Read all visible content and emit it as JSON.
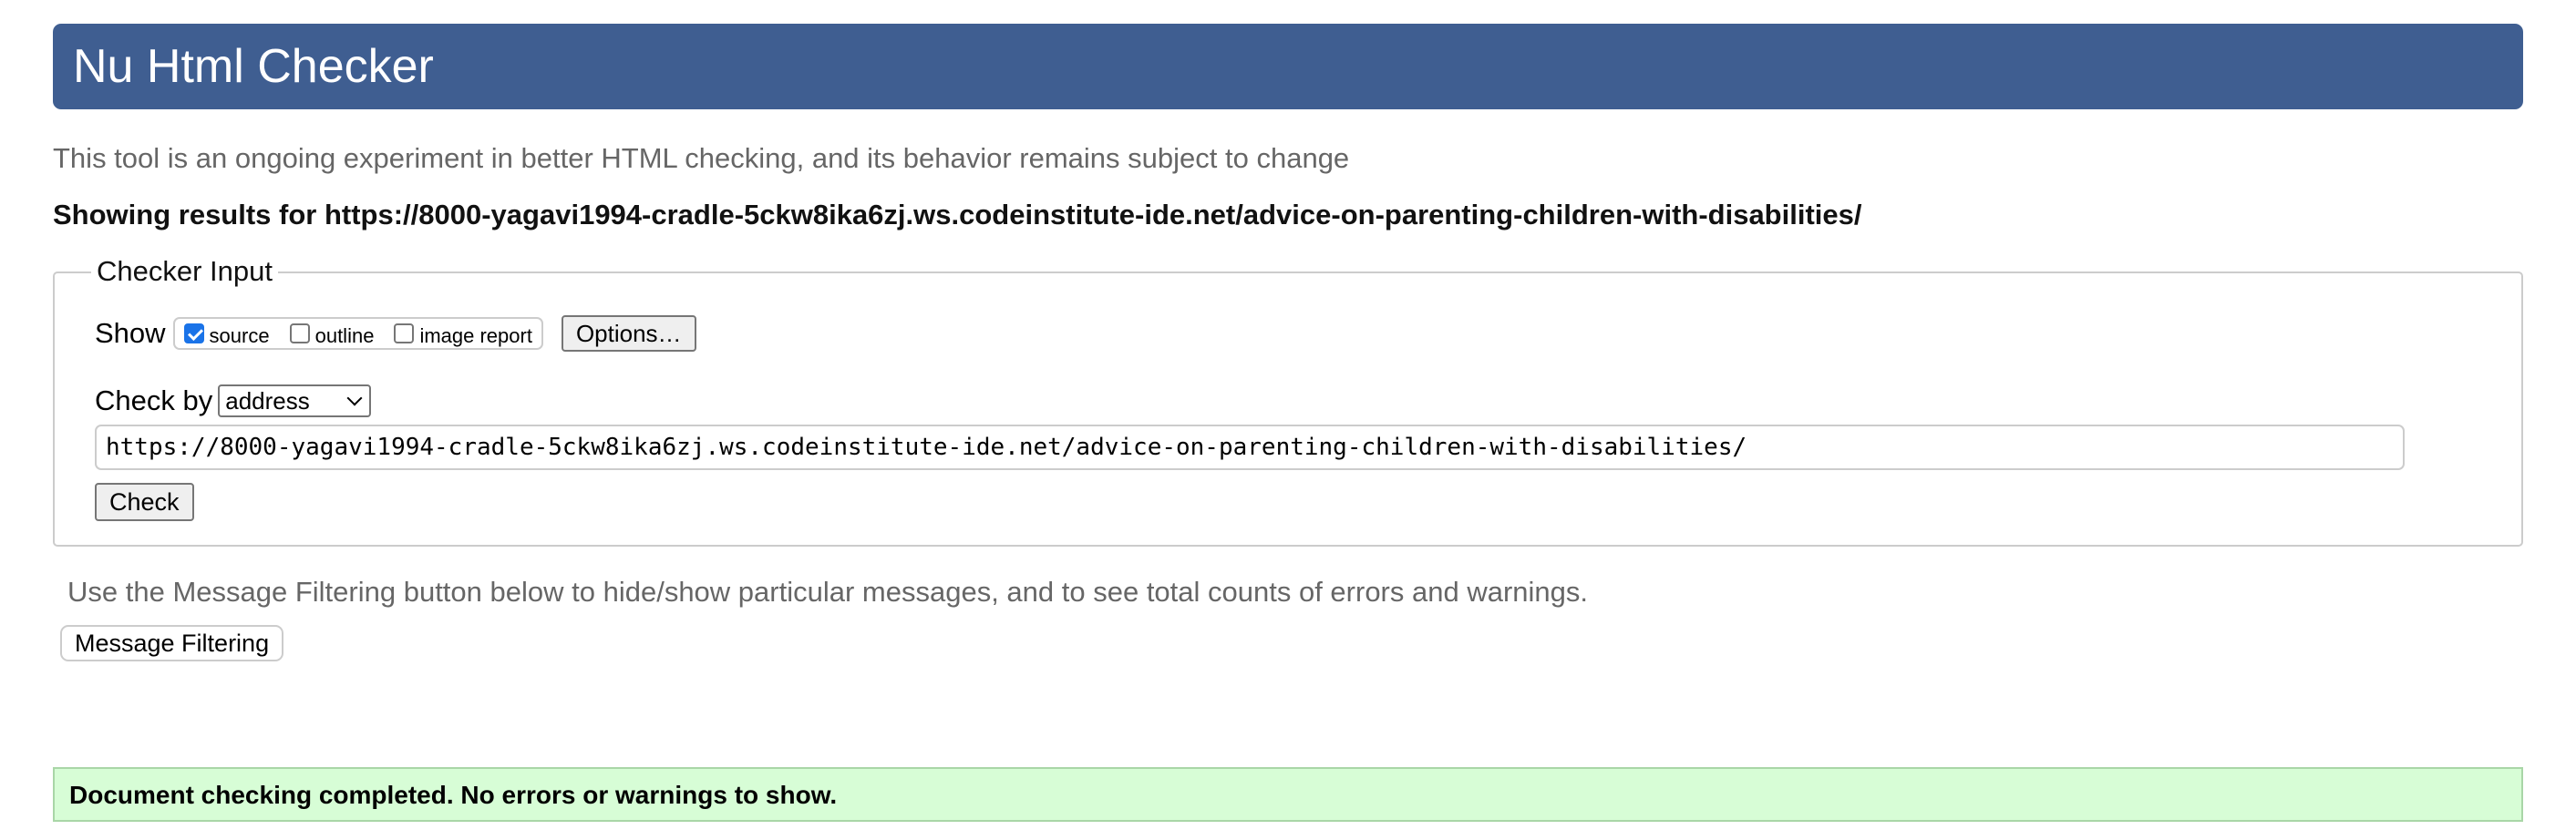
{
  "header": {
    "title": "Nu Html Checker",
    "background_color": "#3f5e91"
  },
  "intro": {
    "subtitle": "This tool is an ongoing experiment in better HTML checking, and its behavior remains subject to change",
    "results_heading": "Showing results for https://8000-yagavi1994-cradle-5ckw8ika6zj.ws.codeinstitute-ide.net/advice-on-parenting-children-with-disabilities/"
  },
  "checker_input": {
    "legend": "Checker Input",
    "show_label": "Show",
    "show_options": [
      {
        "label": "source",
        "checked": true
      },
      {
        "label": "outline",
        "checked": false
      },
      {
        "label": "image report",
        "checked": false
      }
    ],
    "options_button": "Options…",
    "check_by_label": "Check by",
    "check_by_value": "address",
    "url_value": "https://8000-yagavi1994-cradle-5ckw8ika6zj.ws.codeinstitute-ide.net/advice-on-parenting-children-with-disabilities/",
    "check_button": "Check"
  },
  "filtering": {
    "note": "Use the Message Filtering button below to hide/show particular messages, and to see total counts of errors and warnings.",
    "button": "Message Filtering"
  },
  "result": {
    "message": "Document checking completed. No errors or warnings to show.",
    "background_color": "#d7fdd6"
  }
}
